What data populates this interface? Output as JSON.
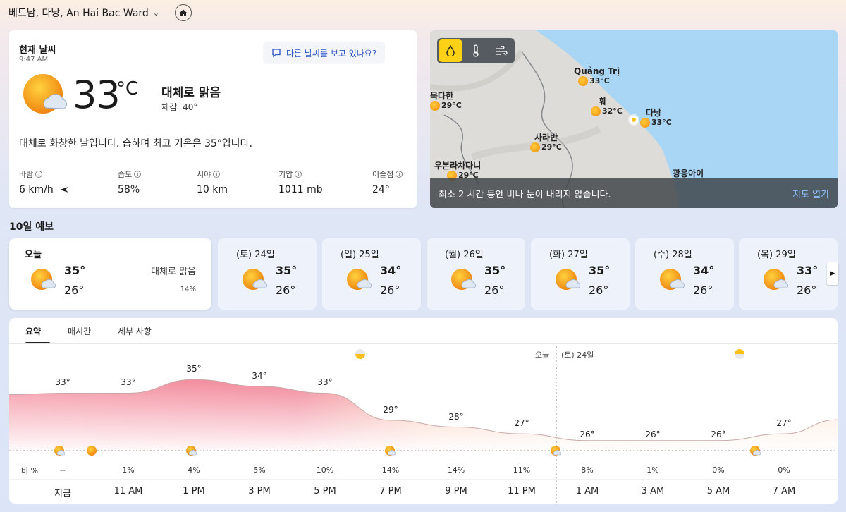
{
  "header": {
    "location": "베트남, 다낭, An Hai Bac Ward"
  },
  "current": {
    "title": "현재 날씨",
    "time": "9:47 AM",
    "other_weather": "다른 날씨를 보고 있나요?",
    "temp": "33",
    "unit": "°C",
    "condition": "대체로 맑음",
    "feels_label": "체감",
    "feels_value": "40°",
    "description": "대체로 화창한 날입니다. 습하며 최고 기온은 35°입니다.",
    "stats": [
      {
        "label": "바람",
        "value": "6 km/h"
      },
      {
        "label": "습도",
        "value": "58%"
      },
      {
        "label": "시야",
        "value": "10 km"
      },
      {
        "label": "기압",
        "value": "1011 mb"
      },
      {
        "label": "이슬점",
        "value": "24°"
      }
    ]
  },
  "map": {
    "cities": [
      {
        "name": "Quảng Trị",
        "temp": "33°C"
      },
      {
        "name": "묵다한",
        "temp": "29°C"
      },
      {
        "name": "훼",
        "temp": "32°C"
      },
      {
        "name": "다낭",
        "temp": "33°C"
      },
      {
        "name": "사라반",
        "temp": "29°C"
      },
      {
        "name": "우본라차다니",
        "temp": "29°C"
      },
      {
        "name": "광응아이",
        "temp": ""
      }
    ],
    "banner": "최소 2 시간 동안 비나 눈이 내리지 않습니다.",
    "open_label": "지도 열기"
  },
  "forecast": {
    "title": "10일 예보",
    "days": [
      {
        "name": "오늘",
        "hi": "35°",
        "lo": "26°",
        "cond": "대체로 맑음",
        "pct": "14%"
      },
      {
        "name": "(토) 24일",
        "hi": "35°",
        "lo": "26°"
      },
      {
        "name": "(일) 25일",
        "hi": "34°",
        "lo": "26°"
      },
      {
        "name": "(월) 26일",
        "hi": "35°",
        "lo": "26°"
      },
      {
        "name": "(화) 27일",
        "hi": "35°",
        "lo": "26°"
      },
      {
        "name": "(수) 28일",
        "hi": "34°",
        "lo": "26°"
      },
      {
        "name": "(목) 29일",
        "hi": "33°",
        "lo": "26°"
      }
    ]
  },
  "hourly": {
    "tabs": [
      "요약",
      "매시간",
      "세부 사항"
    ],
    "today_label": "오늘",
    "next_label": "(토) 24일",
    "rain_label": "비 %",
    "times": [
      "지금",
      "11 AM",
      "1 PM",
      "3 PM",
      "5 PM",
      "7 PM",
      "9 PM",
      "11 PM",
      "1 AM",
      "3 AM",
      "5 AM",
      "7 AM"
    ],
    "temps": [
      "33°",
      "33°",
      "35°",
      "34°",
      "33°",
      "29°",
      "28°",
      "27°",
      "26°",
      "26°",
      "26°",
      "27°"
    ],
    "rain": [
      "--",
      "1%",
      "4%",
      "5%",
      "10%",
      "14%",
      "14%",
      "11%",
      "8%",
      "1%",
      "0%",
      "0%"
    ]
  },
  "chart_data": {
    "type": "area",
    "x": [
      "지금",
      "11 AM",
      "1 PM",
      "3 PM",
      "5 PM",
      "7 PM",
      "9 PM",
      "11 PM",
      "1 AM",
      "3 AM",
      "5 AM",
      "7 AM"
    ],
    "series": [
      {
        "values": [
          33,
          33,
          35,
          34,
          33,
          29,
          28,
          27,
          26,
          26,
          26,
          27
        ]
      }
    ],
    "precip": [
      null,
      1,
      4,
      5,
      10,
      14,
      14,
      11,
      8,
      1,
      0,
      0
    ]
  }
}
